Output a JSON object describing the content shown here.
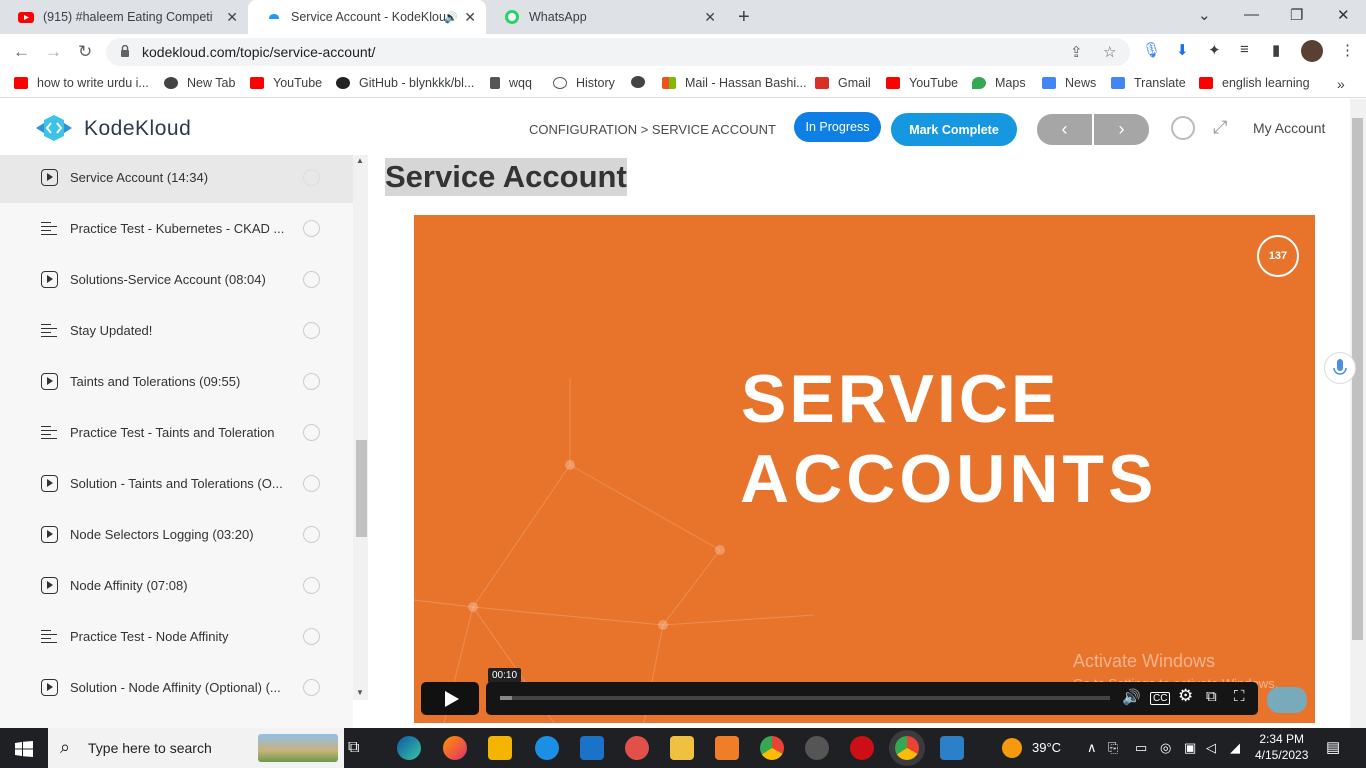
{
  "browser": {
    "tabs": [
      {
        "title": "(915) #haleem Eating Competitio",
        "favicon": "youtube-icon",
        "color": "#ff0000"
      },
      {
        "title": "Service Account - KodeKloud",
        "favicon": "kodekloud-icon",
        "color": "#2196f3",
        "audio": "🔊"
      },
      {
        "title": "WhatsApp",
        "favicon": "whatsapp-icon",
        "color": "#25d366"
      }
    ],
    "url": "kodekloud.com/topic/service-account/",
    "bookmarks": [
      {
        "label": "how to write urdu i...",
        "color": "#ff0000"
      },
      {
        "label": "New Tab",
        "color": "#444"
      },
      {
        "label": "YouTube",
        "color": "#ff0000"
      },
      {
        "label": "GitHub - blynkkk/bl...",
        "color": "#222"
      },
      {
        "label": "wqq",
        "color": "#555"
      },
      {
        "label": "History",
        "color": "#555"
      },
      {
        "label": "",
        "color": "#444"
      },
      {
        "label": "Mail - Hassan Bashi...",
        "color": "#0078d4"
      },
      {
        "label": "Gmail",
        "color": "#d93025"
      },
      {
        "label": "YouTube",
        "color": "#ff0000"
      },
      {
        "label": "Maps",
        "color": "#34a853"
      },
      {
        "label": "News",
        "color": "#4285f4"
      },
      {
        "label": "Translate",
        "color": "#4285f4"
      },
      {
        "label": "english learning",
        "color": "#ff0000"
      }
    ]
  },
  "header": {
    "brand": "KodeKloud",
    "breadcrumb": "CONFIGURATION > SERVICE ACCOUNT",
    "in_progress": "In Progress",
    "mark_complete": "Mark Complete",
    "prev": "‹",
    "next": "›",
    "my_account": "My Account"
  },
  "sidebar": {
    "items": [
      {
        "label": "Service Account (14:34)",
        "type": "video",
        "active": true
      },
      {
        "label": "Practice Test - Kubernetes - CKAD ...",
        "type": "doc"
      },
      {
        "label": "Solutions-Service Account (08:04)",
        "type": "video"
      },
      {
        "label": "Stay Updated!",
        "type": "doc"
      },
      {
        "label": "Taints and Tolerations (09:55)",
        "type": "video"
      },
      {
        "label": "Practice Test - Taints and Toleration",
        "type": "doc"
      },
      {
        "label": "Solution - Taints and Tolerations (O...",
        "type": "video"
      },
      {
        "label": "Node Selectors Logging (03:20)",
        "type": "video"
      },
      {
        "label": "Node Affinity (07:08)",
        "type": "video"
      },
      {
        "label": "Practice Test - Node Affinity",
        "type": "doc"
      },
      {
        "label": "Solution - Node Affinity (Optional) (...",
        "type": "video"
      }
    ]
  },
  "main": {
    "title": "Service Account",
    "video": {
      "line1": "SERVICE",
      "line2": "ACCOUNTS",
      "badge": "137",
      "time_tooltip": "00:10",
      "progress": 0.02,
      "accent": "#e8742c"
    },
    "watermark": {
      "line1": "Activate Windows",
      "line2": "Go to Settings to activate Windows."
    }
  },
  "taskbar": {
    "search_placeholder": "Type here to search",
    "weather": "39°C",
    "time": "2:34 PM",
    "date": "4/15/2023"
  }
}
